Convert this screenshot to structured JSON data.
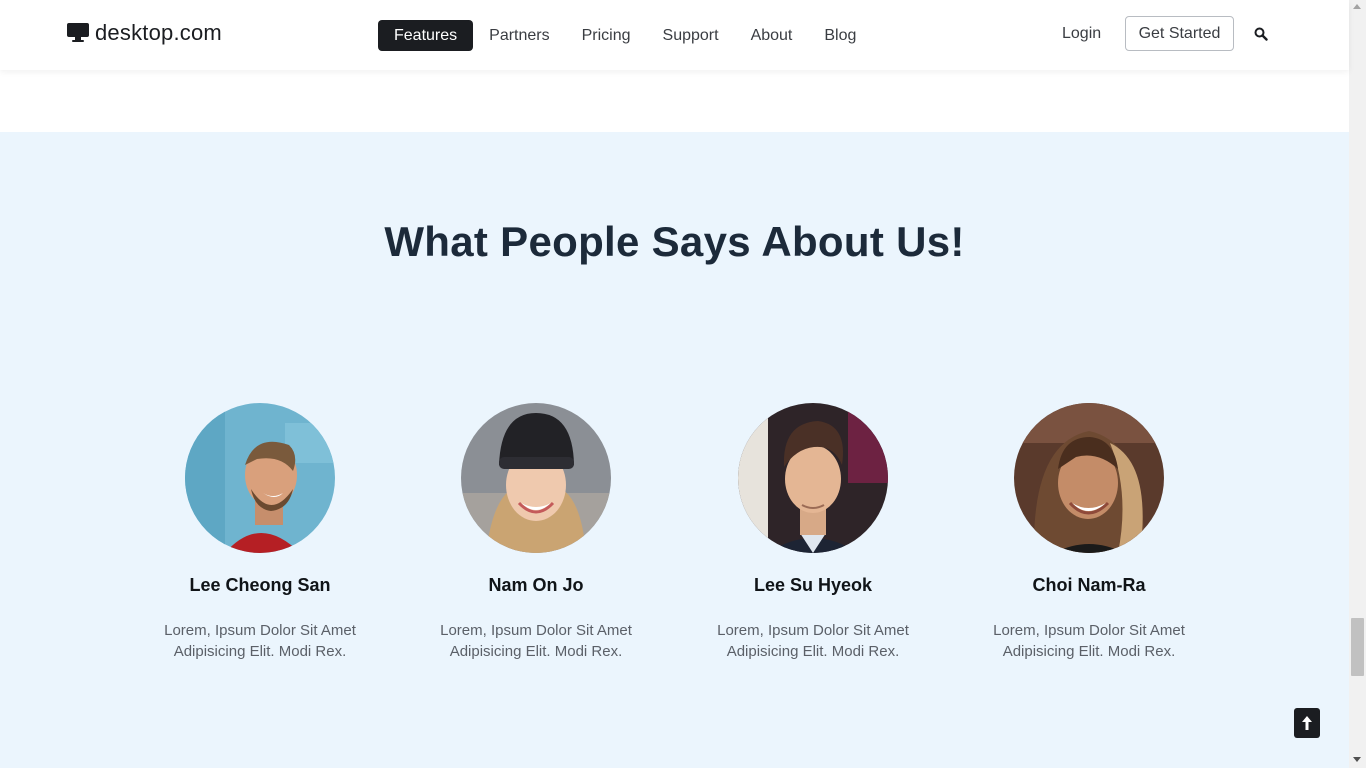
{
  "header": {
    "logo_text": "desktop.com",
    "logo_icon": "monitor-icon",
    "nav": [
      {
        "label": "Features",
        "active": true
      },
      {
        "label": "Partners",
        "active": false
      },
      {
        "label": "Pricing",
        "active": false
      },
      {
        "label": "Support",
        "active": false
      },
      {
        "label": "About",
        "active": false
      },
      {
        "label": "Blog",
        "active": false
      }
    ],
    "login_label": "Login",
    "get_started_label": "Get Started",
    "search_icon": "search-icon"
  },
  "testimonials": {
    "title": "What People Says About Us!",
    "people": [
      {
        "name": "Lee Cheong San",
        "line1": "Lorem, Ipsum Dolor Sit Amet",
        "line2": "Adipisicing Elit. Modi Rex."
      },
      {
        "name": "Nam On Jo",
        "line1": "Lorem, Ipsum Dolor Sit Amet",
        "line2": "Adipisicing Elit. Modi Rex."
      },
      {
        "name": "Lee Su Hyeok",
        "line1": "Lorem, Ipsum Dolor Sit Amet",
        "line2": "Adipisicing Elit. Modi Rex."
      },
      {
        "name": "Choi Nam-Ra",
        "line1": "Lorem, Ipsum Dolor Sit Amet",
        "line2": "Adipisicing Elit. Modi Rex."
      }
    ]
  },
  "colors": {
    "section_bg": "#ebf5fd",
    "dark": "#1b1d21",
    "title": "#1c2a3a"
  },
  "back_to_top_icon": "arrow-up-icon"
}
